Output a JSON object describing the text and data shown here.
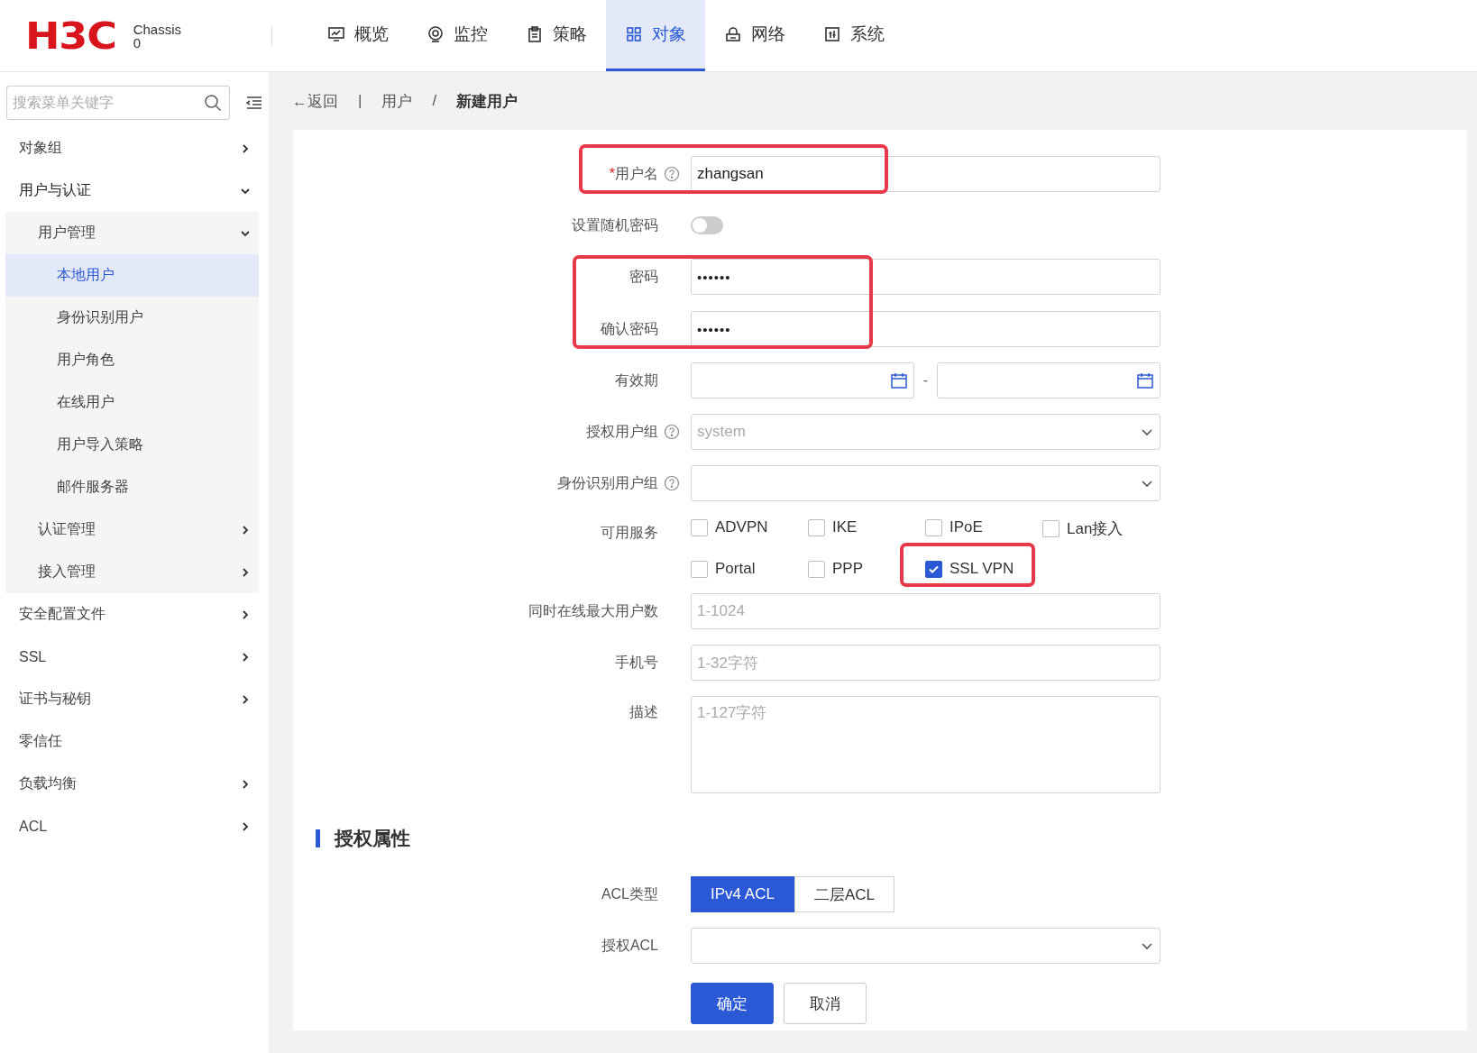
{
  "header": {
    "logo": "H3C",
    "device": {
      "name": "Chassis",
      "slot": "0"
    },
    "nav": [
      {
        "label": "概览",
        "selected": false
      },
      {
        "label": "监控",
        "selected": false
      },
      {
        "label": "策略",
        "selected": false
      },
      {
        "label": "对象",
        "selected": true
      },
      {
        "label": "网络",
        "selected": false
      },
      {
        "label": "系统",
        "selected": false
      }
    ]
  },
  "sidebar": {
    "search": {
      "placeholder": "搜索菜单关键字"
    },
    "items": [
      {
        "label": "对象组",
        "expanded": false,
        "selected": false
      },
      {
        "label": "用户与认证",
        "expanded": true,
        "selected": false,
        "children": [
          {
            "label": "用户管理",
            "expanded": true,
            "selected": false,
            "children": [
              {
                "label": "本地用户",
                "selected": true
              },
              {
                "label": "身份识别用户",
                "selected": false
              },
              {
                "label": "用户角色",
                "selected": false
              },
              {
                "label": "在线用户",
                "selected": false
              },
              {
                "label": "用户导入策略",
                "selected": false
              },
              {
                "label": "邮件服务器",
                "selected": false
              }
            ]
          },
          {
            "label": "认证管理",
            "expanded": false,
            "selected": false
          },
          {
            "label": "接入管理",
            "expanded": false,
            "selected": false
          }
        ]
      },
      {
        "label": "安全配置文件",
        "expanded": false,
        "selected": false
      },
      {
        "label": "SSL",
        "expanded": false,
        "selected": false
      },
      {
        "label": "证书与秘钥",
        "expanded": false,
        "selected": false
      },
      {
        "label": "零信任",
        "selected": false
      },
      {
        "label": "负载均衡",
        "expanded": false,
        "selected": false
      },
      {
        "label": "ACL",
        "expanded": false,
        "selected": false
      }
    ]
  },
  "breadcrumb": {
    "back": "←返回",
    "separator": "|",
    "path": [
      "用户",
      "新建用户"
    ],
    "path_separator": "/"
  },
  "form": {
    "rows": [
      {
        "kind": "text",
        "label": "用户名",
        "required_mark": "*",
        "help": true,
        "value": "zhangsan",
        "highlighted": true
      },
      {
        "kind": "toggle",
        "label": "设置随机密码",
        "on": false
      },
      {
        "kind": "group",
        "highlighted": true,
        "rows": [
          {
            "kind": "password",
            "label": "密码",
            "value": "••••••"
          },
          {
            "kind": "password",
            "label": "确认密码",
            "value": "••••••"
          }
        ]
      },
      {
        "kind": "daterange",
        "label": "有效期",
        "separator": "-"
      },
      {
        "kind": "select",
        "label": "授权用户组",
        "help": true,
        "placeholder": "system"
      },
      {
        "kind": "select",
        "label": "身份识别用户组",
        "help": true
      },
      {
        "kind": "checkboxes",
        "label": "可用服务",
        "options": [
          {
            "label": "ADVPN",
            "checked": false
          },
          {
            "label": "IKE",
            "checked": false
          },
          {
            "label": "IPoE",
            "checked": false
          },
          {
            "label": "Lan接入",
            "checked": false
          },
          {
            "label": "Portal",
            "checked": false
          },
          {
            "label": "PPP",
            "checked": false
          },
          {
            "label": "SSL VPN",
            "checked": true,
            "highlighted": true
          }
        ]
      },
      {
        "kind": "text",
        "label": "同时在线最大用户数",
        "placeholder": "1-1024"
      },
      {
        "kind": "text",
        "label": "手机号",
        "placeholder": "1-32字符"
      },
      {
        "kind": "textarea",
        "label": "描述",
        "placeholder": "1-127字符"
      }
    ],
    "section": {
      "title": "授权属性",
      "rows": [
        {
          "kind": "segmented",
          "label": "ACL类型",
          "options": [
            {
              "label": "IPv4 ACL",
              "selected": true
            },
            {
              "label": "二层ACL",
              "selected": false
            }
          ]
        },
        {
          "kind": "select",
          "label": "授权ACL"
        }
      ]
    },
    "buttons": [
      {
        "label": "确定",
        "kind": "primary"
      },
      {
        "label": "取消",
        "kind": "secondary"
      }
    ]
  }
}
